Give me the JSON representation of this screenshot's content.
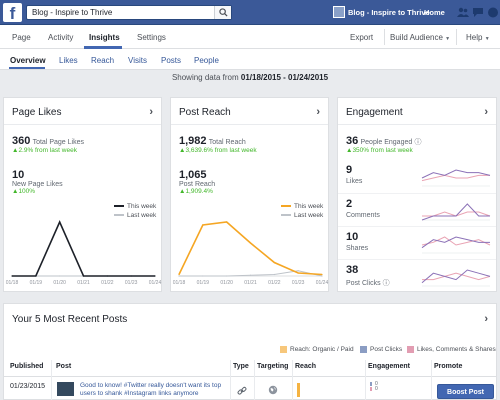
{
  "topbar": {
    "logo": "f",
    "search_value": "Blog - Inspire to Thrive",
    "page_name": "Blog - Inspire to Thrive",
    "home": "Home"
  },
  "pagenav": {
    "items": [
      "Page",
      "Activity",
      "Insights",
      "Settings"
    ],
    "right": [
      "Export",
      "Build Audience",
      "Help"
    ]
  },
  "subnav": {
    "items": [
      "Overview",
      "Likes",
      "Reach",
      "Visits",
      "Posts",
      "People"
    ]
  },
  "daterange": {
    "prefix": "Showing data from",
    "range": "01/18/2015 - 01/24/2015"
  },
  "page_likes": {
    "title": "Page Likes",
    "total_value": "360",
    "total_label": "Total Page Likes",
    "total_change": "2.9% from last week",
    "new_value": "10",
    "new_label": "New Page Likes",
    "new_change": "100%",
    "legend_this": "This week",
    "legend_last": "Last week"
  },
  "post_reach": {
    "title": "Post Reach",
    "total_value": "1,982",
    "total_label": "Total Reach",
    "total_change": "3,639.6% from last week",
    "post_value": "1,065",
    "post_label": "Post Reach",
    "post_change": "1,909.4%",
    "legend_this": "This week",
    "legend_last": "Last week"
  },
  "engagement": {
    "title": "Engagement",
    "people_value": "36",
    "people_label": "People Engaged",
    "people_change": "350% from last week",
    "rows": [
      {
        "value": "9",
        "label": "Likes"
      },
      {
        "value": "2",
        "label": "Comments"
      },
      {
        "value": "10",
        "label": "Shares"
      },
      {
        "value": "38",
        "label": "Post Clicks"
      }
    ]
  },
  "chart_data": [
    {
      "type": "line",
      "x": [
        "01/18",
        "01/19",
        "01/20",
        "01/21",
        "01/22",
        "01/23",
        "01/24"
      ],
      "series": [
        {
          "name": "This week",
          "values": [
            0,
            0,
            9,
            0,
            0,
            0,
            0
          ]
        },
        {
          "name": "Last week",
          "values": [
            0,
            0,
            0,
            0,
            0,
            0,
            0
          ]
        }
      ],
      "ylim": [
        0,
        10
      ]
    },
    {
      "type": "line",
      "x": [
        "01/18",
        "01/19",
        "01/20",
        "01/21",
        "01/22",
        "01/23",
        "01/24"
      ],
      "series": [
        {
          "name": "This week",
          "values": [
            20,
            680,
            720,
            440,
            180,
            40,
            20
          ]
        },
        {
          "name": "Last week",
          "values": [
            0,
            0,
            0,
            10,
            20,
            70,
            0
          ]
        }
      ],
      "ylim": [
        0,
        800
      ]
    }
  ],
  "sparklines": [
    {
      "a": [
        3,
        5,
        4,
        6,
        5,
        5,
        4
      ],
      "b": [
        2,
        3,
        4,
        3,
        3,
        4,
        4
      ]
    },
    {
      "a": [
        0,
        1,
        1,
        1,
        4,
        1,
        1
      ],
      "b": [
        1,
        1,
        2,
        1,
        2,
        2,
        1
      ]
    },
    {
      "a": [
        2,
        5,
        4,
        6,
        5,
        4,
        4
      ],
      "b": [
        3,
        4,
        6,
        3,
        4,
        5,
        3
      ]
    },
    {
      "a": [
        1,
        4,
        3,
        2,
        5,
        4,
        3
      ],
      "b": [
        2,
        2,
        3,
        4,
        3,
        2,
        3
      ]
    }
  ],
  "colors": {
    "this_likes": "#1d2129",
    "this_reach": "#f5a623",
    "last_week": "#bec3c9",
    "spark_a": "#8b71b7",
    "spark_b": "#e9a3b3",
    "reach_bar": "#f5b342",
    "clicks": "#8b9dc3",
    "likes_cs": "#e29db2"
  },
  "posts": {
    "title": "Your 5 Most Recent Posts",
    "legend": [
      "Reach: Organic / Paid",
      "Post Clicks",
      "Likes, Comments & Shares"
    ],
    "headers": [
      "Published",
      "Post",
      "Type",
      "Targeting",
      "Reach",
      "Engagement",
      "Promote"
    ],
    "row": {
      "date": "01/23/2015",
      "text": "Good to know! #Twitter really doesn't want its top users to shank #Instagram links anymore",
      "eng_top": "0",
      "eng_bottom": "0",
      "boost": "Boost Post"
    }
  }
}
